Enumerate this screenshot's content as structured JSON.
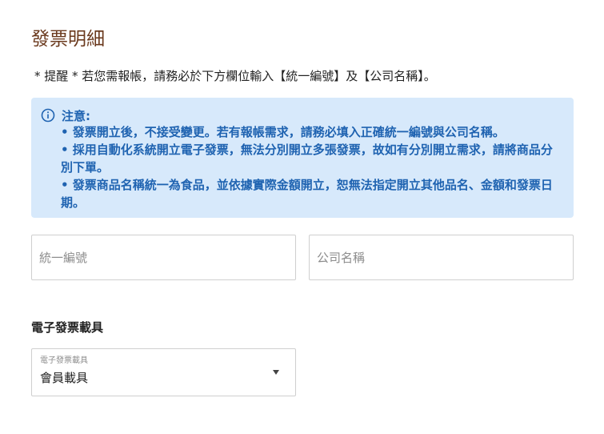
{
  "page": {
    "title": "發票明細",
    "reminder": "* 提醒 * 若您需報帳，請務必於下方欄位輸入【統一編號】及【公司名稱】。"
  },
  "notice": {
    "icon": "info-icon",
    "heading": "注意:",
    "items": [
      "• 發票開立後，不接受變更。若有報帳需求，請務必填入正確統一編號與公司名稱。",
      "• 採用自動化系統開立電子發票，無法分別開立多張發票，故如有分別開立需求，請將商品分別下單。",
      "• 發票商品名稱統一為食品，並依據實際金額開立，恕無法指定開立其他品名、金額和發票日期。"
    ],
    "colors": {
      "background": "#d7e9fb",
      "text": "#1f63b1"
    }
  },
  "form": {
    "tax_id": {
      "placeholder": "統一編號",
      "value": ""
    },
    "company_name": {
      "placeholder": "公司名稱",
      "value": ""
    }
  },
  "carrier": {
    "heading": "電子發票載具",
    "select_label": "電子發票載具",
    "selected_value": "會員載具",
    "icon": "chevron-down-icon"
  },
  "colors": {
    "title": "#6b3a1e"
  }
}
